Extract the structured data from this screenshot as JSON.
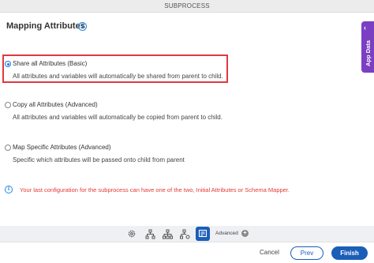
{
  "window": {
    "title": "SUBPROCESS"
  },
  "header": {
    "title": "Mapping Attributes",
    "info_icon": "info-icon"
  },
  "side_tab": {
    "label": "App Data",
    "icon": "chevron-left-icon",
    "color": "#7b3fc4"
  },
  "options": [
    {
      "label": "Share all Attributes (Basic)",
      "description": "All attributes and variables will automatically be shared from parent to child.",
      "selected": true
    },
    {
      "label": "Copy all Attributes (Advanced)",
      "description": "All attributes and variables will automatically be copied from parent to child.",
      "selected": false
    },
    {
      "label": "Map Specific Attributes (Advanced)",
      "description": "Specific which attributes will be passed onto child from parent",
      "selected": false
    }
  ],
  "notice": {
    "text": "Your last configuration for the subprocess can have one of the two, Initial Attributes or Schema Mapper.",
    "color": "#e53935"
  },
  "toolbar": {
    "tools": [
      "gear-icon",
      "hierarchy-icon",
      "hierarchy-split-icon",
      "hierarchy-settings-icon",
      "mapping-icon"
    ],
    "active_tool": "mapping-icon",
    "advanced_label": "Advanced"
  },
  "footer": {
    "cancel_label": "Cancel",
    "prev_label": "Prev",
    "finish_label": "Finish",
    "accent": "#1b5eb8"
  }
}
